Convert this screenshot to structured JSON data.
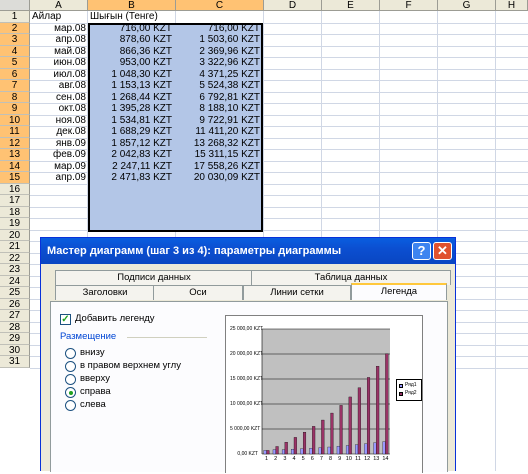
{
  "sheet": {
    "columns": [
      "A",
      "B",
      "C",
      "D",
      "E",
      "F",
      "G",
      "H"
    ],
    "rows": [
      "1",
      "2",
      "3",
      "4",
      "5",
      "6",
      "7",
      "8",
      "9",
      "10",
      "11",
      "12",
      "13",
      "14",
      "15",
      "16",
      "17",
      "18",
      "19",
      "20",
      "21",
      "22",
      "23",
      "24",
      "25",
      "26",
      "27",
      "28",
      "29",
      "30",
      "31"
    ],
    "header": {
      "a": "Айлар",
      "b": "Шығын (Тенге)",
      "c": ""
    },
    "data": [
      {
        "month": "мар.08",
        "spend": "716,00 KZT",
        "cumulative": "716,00 KZT"
      },
      {
        "month": "апр.08",
        "spend": "878,60 KZT",
        "cumulative": "1 503,60 KZT"
      },
      {
        "month": "май.08",
        "spend": "866,36 KZT",
        "cumulative": "2 369,96 KZT"
      },
      {
        "month": "июн.08",
        "spend": "953,00 KZT",
        "cumulative": "3 322,96 KZT"
      },
      {
        "month": "июл.08",
        "spend": "1 048,30 KZT",
        "cumulative": "4 371,25 KZT"
      },
      {
        "month": "авг.08",
        "spend": "1 153,13 KZT",
        "cumulative": "5 524,38 KZT"
      },
      {
        "month": "сен.08",
        "spend": "1 268,44 KZT",
        "cumulative": "6 792,81 KZT"
      },
      {
        "month": "окт.08",
        "spend": "1 395,28 KZT",
        "cumulative": "8 188,10 KZT"
      },
      {
        "month": "ноя.08",
        "spend": "1 534,81 KZT",
        "cumulative": "9 722,91 KZT"
      },
      {
        "month": "дек.08",
        "spend": "1 688,29 KZT",
        "cumulative": "11 411,20 KZT"
      },
      {
        "month": "янв.09",
        "spend": "1 857,12 KZT",
        "cumulative": "13 268,32 KZT"
      },
      {
        "month": "фев.09",
        "spend": "2 042,83 KZT",
        "cumulative": "15 311,15 KZT"
      },
      {
        "month": "мар.09",
        "spend": "2 247,11 KZT",
        "cumulative": "17 558,26 KZT"
      },
      {
        "month": "апр.09",
        "spend": "2 471,83 KZT",
        "cumulative": "20 030,09 KZT"
      }
    ]
  },
  "dialog": {
    "title": "Мастер диаграмм (шаг 3 из 4): параметры диаграммы",
    "help_label": "?",
    "close_label": "✕",
    "tabs_back": [
      "Подписи данных",
      "Таблица данных"
    ],
    "tabs_front": [
      "Заголовки",
      "Оси",
      "Линии сетки",
      "Легенда"
    ],
    "active_tab": "Легенда",
    "show_legend_label": "Добавить легенду",
    "show_legend_checked": true,
    "placement_group": "Размещение",
    "placement_options": [
      "внизу",
      "в правом верхнем углу",
      "вверху",
      "справа",
      "слева"
    ],
    "placement_selected": "справа"
  },
  "chart_data": {
    "type": "bar",
    "categories": [
      "1",
      "2",
      "3",
      "4",
      "5",
      "6",
      "7",
      "8",
      "9",
      "10",
      "11",
      "12",
      "13",
      "14"
    ],
    "series": [
      {
        "name": "Ряд1",
        "values": [
          716.0,
          878.6,
          866.36,
          953.0,
          1048.3,
          1153.13,
          1268.44,
          1395.28,
          1534.81,
          1688.29,
          1857.12,
          2042.83,
          2247.11,
          2471.83
        ]
      },
      {
        "name": "Ряд2",
        "values": [
          716.0,
          1503.6,
          2369.96,
          3322.96,
          4371.25,
          5524.38,
          6792.81,
          8188.1,
          9722.91,
          11411.2,
          13268.32,
          15311.15,
          17558.26,
          20030.09
        ]
      }
    ],
    "yticks": [
      "25 000,00 KZT",
      "20 000,00 KZT",
      "15 000,00 KZT",
      "10 000,00 KZT",
      "5 000,00 KZT",
      "0,00 KZT"
    ],
    "ylim": [
      0,
      25000
    ],
    "legend": "right",
    "grid": true,
    "colors": {
      "series1": "#9999ff",
      "series2": "#993366",
      "plot_bg": "#c0c0c0"
    }
  }
}
